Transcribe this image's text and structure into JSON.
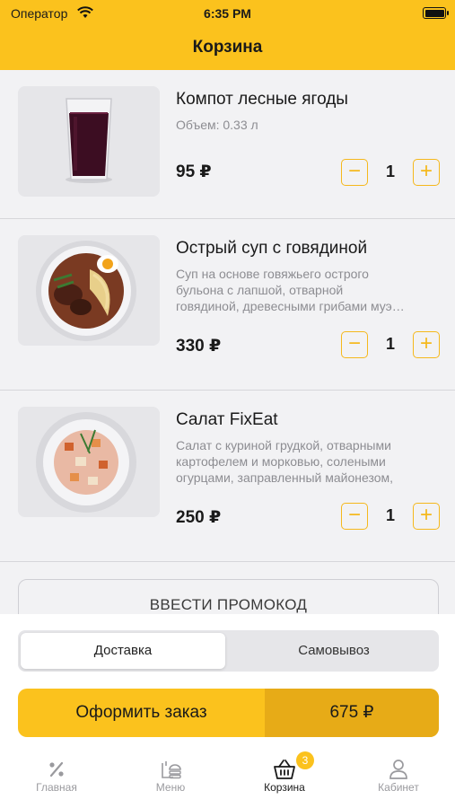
{
  "status_bar": {
    "carrier": "Оператор",
    "time": "6:35 PM"
  },
  "header": {
    "title": "Корзина"
  },
  "items": [
    {
      "name": "Компот лесные ягоды",
      "desc": [
        "Объем: 0.33 л"
      ],
      "price": "95 ₽",
      "qty": "1"
    },
    {
      "name": "Острый суп с говядиной",
      "desc": [
        "Суп на основе говяжьего острого",
        "бульона с лапшой, отварной",
        "говядиной, древесными грибами муэ…"
      ],
      "price": "330 ₽",
      "qty": "1"
    },
    {
      "name": "Салат FixEat",
      "desc": [
        "Салат с куриной грудкой, отварными",
        "картофелем и морковью, солеными",
        "огурцами, заправленный майонезом,"
      ],
      "price": "250 ₽",
      "qty": "1"
    }
  ],
  "stepper": {
    "minus": "−",
    "plus": "+"
  },
  "promo": {
    "label": "ВВЕСТИ ПРОМОКОД"
  },
  "delivery": {
    "options": [
      "Доставка",
      "Самовывоз"
    ],
    "selected": "Доставка"
  },
  "order": {
    "label": "Оформить заказ",
    "total": "675 ₽"
  },
  "tabbar": {
    "tabs": [
      {
        "label": "Главная",
        "icon": "percent-icon"
      },
      {
        "label": "Меню",
        "icon": "menu-food-icon"
      },
      {
        "label": "Корзина",
        "icon": "basket-icon",
        "badge": "3",
        "active": true
      },
      {
        "label": "Кабинет",
        "icon": "user-icon"
      }
    ]
  },
  "colors": {
    "accent": "#fbc21d",
    "accent_dark": "#e7ab17",
    "stepper": "#f5b81c"
  }
}
